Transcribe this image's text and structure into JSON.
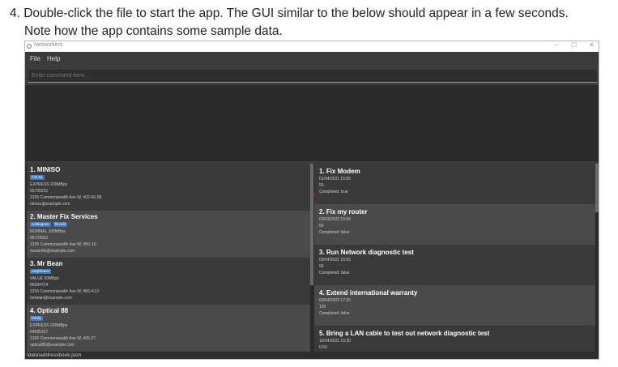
{
  "instruction": {
    "line1": "4. Double-click the file to start the app. The GUI similar to the below should appear in a few seconds.",
    "line2": "Note how the app contains some sample data."
  },
  "window": {
    "title": "Networkers",
    "controls": {
      "minimize": "–",
      "maximize": "☐",
      "close": "✕"
    }
  },
  "menu": {
    "file": "File",
    "help": "Help"
  },
  "command_box": {
    "placeholder": "Enter command here...",
    "value": ""
  },
  "persons": [
    {
      "title": "1.  MINISO",
      "tags": [
        "friends"
      ],
      "plan": "EXPRESS 200MBps",
      "phone": "65705231",
      "address": "3155 Commonwealth Ave W, #02-56-58",
      "email": "miniso@example.com"
    },
    {
      "title": "2.  Master Fix Services",
      "tags": [
        "colleagues",
        "friends"
      ],
      "plan": "NORMAL 100MBps",
      "phone": "96724552",
      "address": "3155 Commonwealth Ave W, #B1-10",
      "email": "masterfix@example.com"
    },
    {
      "title": "3.  Mr Bean",
      "tags": [
        "neighbours"
      ],
      "plan": "VALUE 50MBps",
      "phone": "66594724",
      "address": "3155 Commonwealth Ave W, #B1-K13",
      "email": "mrbean@example.com"
    },
    {
      "title": "4.  Optical 88",
      "tags": [
        "family"
      ],
      "plan": "EXPRESS 200MBps",
      "phone": "64595327",
      "address": "3155 Commonwealth Ave W, #05-27",
      "email": "optical88@example.com"
    }
  ],
  "tasks": [
    {
      "title": "1.  Fix Modem",
      "datetime": "01/04/2021 15:55",
      "cost": "50",
      "completed": "Completed: true"
    },
    {
      "title": "2.  Fix my router",
      "datetime": "03/03/2022 15:55",
      "cost": "50",
      "completed": "Completed: false"
    },
    {
      "title": "3.  Run Network diagnostic test",
      "datetime": "03/04/2022 15:55",
      "cost": "50",
      "completed": "Completed: false"
    },
    {
      "title": "4.  Extend international warranty",
      "datetime": "03/04/2022 17:30",
      "cost": "150",
      "completed": "Completed: false"
    },
    {
      "title": "5.  Bring a LAN cable to test out network diagnostic test",
      "datetime": "10/04/2022 15:30",
      "cost": "0.50",
      "completed": ""
    }
  ],
  "status_bar": {
    "path": "\\data\\addressbook.json"
  },
  "colors": {
    "tag": "#3e7bbf",
    "panel_dark": "#2b2b2b",
    "card_odd": "#3a3a3a",
    "card_even": "#4a4a4a"
  }
}
